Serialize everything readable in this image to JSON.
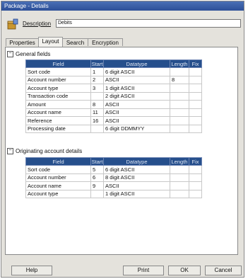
{
  "window": {
    "title": "Package - Details"
  },
  "description": {
    "label": "Description",
    "value": "Debits"
  },
  "tabs": [
    {
      "label": "Properties",
      "active": false
    },
    {
      "label": "Layout",
      "active": true
    },
    {
      "label": "Search",
      "active": false
    },
    {
      "label": "Encryption",
      "active": false
    }
  ],
  "columns": [
    "Field",
    "Start",
    "Datatype",
    "Length",
    "Fix"
  ],
  "sections": [
    {
      "title": "General fields",
      "rows": [
        [
          "Sort code",
          "1",
          "6 digit ASCII",
          "",
          ""
        ],
        [
          "Account number",
          "2",
          "ASCII",
          "8",
          ""
        ],
        [
          "Account type",
          "3",
          "1 digit ASCII",
          "",
          ""
        ],
        [
          "Transaction code",
          "",
          "2 digit ASCII",
          "",
          ""
        ],
        [
          "Amount",
          "8",
          "ASCII",
          "",
          ""
        ],
        [
          "Account name",
          "11",
          "ASCII",
          "",
          ""
        ],
        [
          "Reference",
          "16",
          "ASCII",
          "",
          ""
        ],
        [
          "Processing date",
          "",
          "6 digit DDMMYY",
          "",
          ""
        ]
      ]
    },
    {
      "title": "Originating account details",
      "rows": [
        [
          "Sort code",
          "5",
          "6 digit ASCII",
          "",
          ""
        ],
        [
          "Account number",
          "6",
          "8 digit ASCII",
          "",
          ""
        ],
        [
          "Account name",
          "9",
          "ASCII",
          "",
          ""
        ],
        [
          "Account type",
          "",
          "1 digit ASCII",
          "",
          ""
        ]
      ]
    }
  ],
  "buttons": {
    "help": "Help",
    "print": "Print",
    "ok": "OK",
    "cancel": "Cancel"
  }
}
